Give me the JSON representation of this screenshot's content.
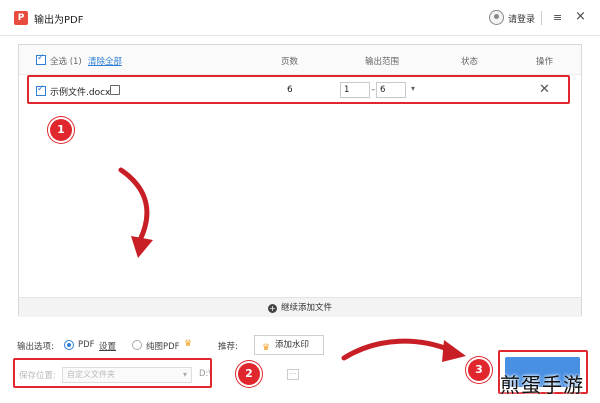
{
  "window": {
    "title": "输出为PDF",
    "app_icon": "pdf-app-icon",
    "login_label": "请登录",
    "menu_icon": "≡",
    "close_icon": "×"
  },
  "table": {
    "select_all_label": "全选 (1)",
    "clear_all_label": "清除全部",
    "columns": {
      "pages": "页数",
      "range": "输出范围",
      "status": "状态",
      "actions": "操作"
    },
    "rows": [
      {
        "checked": true,
        "filename": "示例文件.docx",
        "pages": "6",
        "range_from": "1",
        "range_to": "6",
        "status": ""
      }
    ],
    "add_more_label": "继续添加文件"
  },
  "options": {
    "output_label": "输出选项:",
    "pdf_label": "PDF",
    "settings_label": "设置",
    "image_pdf_label": "纯图PDF",
    "recommend_label": "推荐:",
    "watermark_label": "添加水印"
  },
  "save": {
    "label": "保存位置:",
    "select_value": "自定义文件夹",
    "path": "D:\\",
    "browse_label": "···"
  },
  "annotations": {
    "step1": "1",
    "step2": "2",
    "step3": "3",
    "accent_color": "#e0272e"
  },
  "watermark_text": "煎蛋手游",
  "colors": {
    "primary": "#2f7fd6",
    "export_button": "#4a90e2"
  }
}
